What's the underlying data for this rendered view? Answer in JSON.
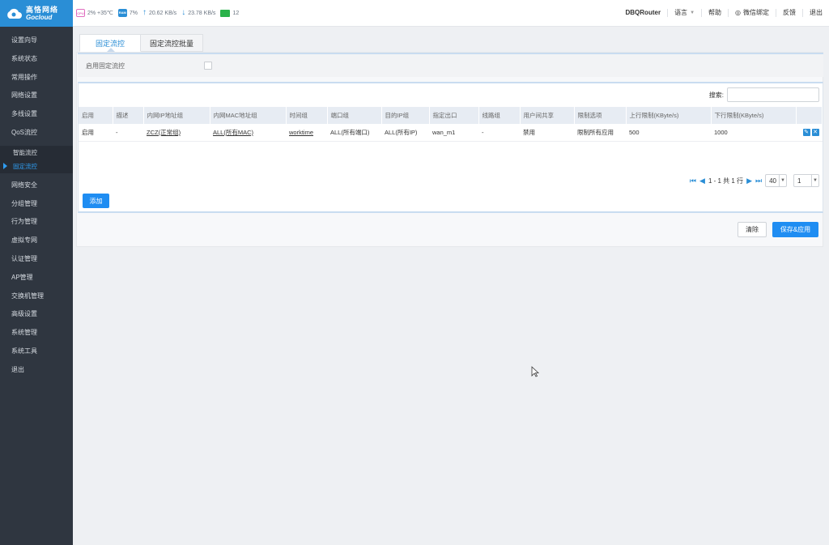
{
  "logo": {
    "cn": "高恪网络",
    "en": "Gocloud"
  },
  "sidebar": {
    "items": [
      {
        "label": "设置向导"
      },
      {
        "label": "系统状态"
      },
      {
        "label": "常用操作"
      },
      {
        "label": "网络设置"
      },
      {
        "label": "多线设置"
      },
      {
        "label": "QoS流控"
      }
    ],
    "subitems": [
      {
        "label": "智能流控"
      },
      {
        "label": "固定流控"
      }
    ],
    "items2": [
      {
        "label": "网络安全"
      },
      {
        "label": "分组管理"
      },
      {
        "label": "行为管理"
      },
      {
        "label": "虚拟专网"
      },
      {
        "label": "认证管理"
      },
      {
        "label": "AP管理"
      },
      {
        "label": "交换机管理"
      },
      {
        "label": "高级设置"
      },
      {
        "label": "系统管理"
      },
      {
        "label": "系统工具"
      },
      {
        "label": "退出"
      }
    ]
  },
  "status": {
    "cpu_chip": "CPU",
    "cpu": "2% +35℃",
    "ram_chip": "RAM",
    "ram": "7%",
    "upload": "20.62 KB/s",
    "download": "23.78 KB/s",
    "clients": "12"
  },
  "topbar": {
    "router": "DBQRouter",
    "language": "语言",
    "help": "帮助",
    "wechat": "微信绑定",
    "feedback": "反馈",
    "logout": "退出"
  },
  "tabs": [
    {
      "label": "固定流控"
    },
    {
      "label": "固定流控批量"
    }
  ],
  "enable": {
    "label": "启用固定流控"
  },
  "search": {
    "label": "搜索:",
    "placeholder": ""
  },
  "table": {
    "headers": [
      "启用",
      "描述",
      "内网IP地址组",
      "内网MAC地址组",
      "时间组",
      "端口组",
      "目的IP组",
      "指定出口",
      "线路组",
      "用户间共享",
      "限制选项",
      "上行限制(KByte/s)",
      "下行限制(KByte/s)",
      ""
    ],
    "rows": [
      [
        "启用",
        "-",
        "ZCZ(正常组)",
        "ALL(所有MAC)",
        "worktime",
        "ALL(所有端口)",
        "ALL(所有IP)",
        "wan_m1",
        "-",
        "禁用",
        "限制所有应用",
        "500",
        "1000"
      ]
    ]
  },
  "pager": {
    "info": "1 - 1 共 1 行",
    "page_size": "40",
    "page": "1"
  },
  "buttons": {
    "add": "添加",
    "clear": "清除",
    "save": "保存&应用"
  },
  "colors": {
    "accent": "#1f8df2",
    "sidebar_bg": "#2f3640",
    "logo_bg": "#2a8ed6"
  }
}
